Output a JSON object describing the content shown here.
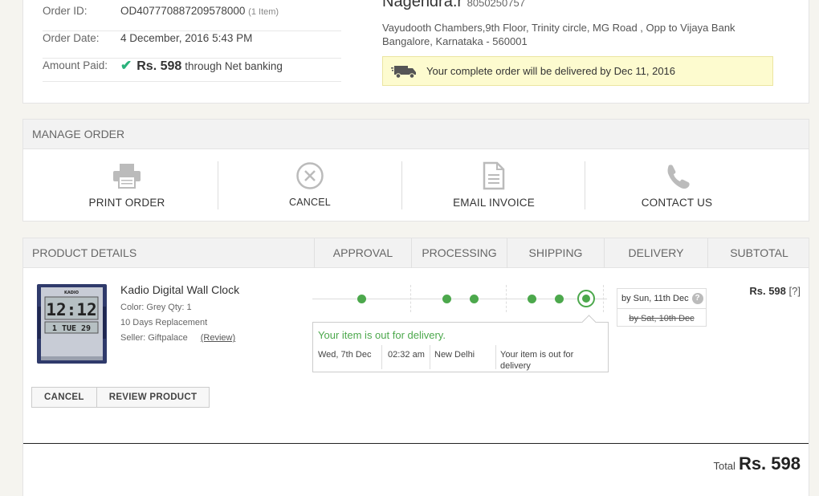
{
  "order": {
    "id_label": "Order ID:",
    "id": "OD407770887209578000",
    "items": "(1 Item)",
    "date_label": "Order Date:",
    "date": "4 December, 2016 5:43 PM",
    "amount_label": "Amount Paid:",
    "amount": "Rs. 598",
    "payment_method": "through Net banking"
  },
  "customer": {
    "name": "Nagendra.r",
    "phone": "8050250757",
    "address_line1": "Vayudooth Chambers,9th Floor, Trinity circle, MG Road , Opp to Vijaya Bank",
    "address_line2": "Bangalore, Karnataka - 560001"
  },
  "delivery_banner": "Your complete order will be delivered by Dec 11, 2016",
  "manage": {
    "title": "MANAGE ORDER",
    "actions": [
      {
        "label": "PRINT ORDER",
        "icon": "printer-icon"
      },
      {
        "label": "CANCEL",
        "icon": "cancel-circle-icon"
      },
      {
        "label": "EMAIL INVOICE",
        "icon": "document-icon"
      },
      {
        "label": "CONTACT US",
        "icon": "phone-icon"
      }
    ]
  },
  "product_table": {
    "headers": [
      "PRODUCT DETAILS",
      "APPROVAL",
      "PROCESSING",
      "SHIPPING",
      "DELIVERY",
      "SUBTOTAL"
    ]
  },
  "product": {
    "name": "Kadio Digital Wall Clock",
    "color_qty": "Color: Grey  Qty: 1",
    "replacement": "10 Days Replacement",
    "seller": "Seller: Giftpalace",
    "review_link": "(Review)",
    "clock_brand": "KADIO",
    "clock_time": "12:12",
    "clock_day": "1 TUE 29",
    "subtotal": "Rs. 598",
    "subtotal_help": "[?]"
  },
  "tracking": {
    "status": "Your item is out for delivery.",
    "date": "Wed, 7th Dec",
    "time": "02:32 am",
    "location": "New Delhi",
    "detail": "Your item is out for delivery",
    "eta_new": "by Sun, 11th Dec",
    "eta_help": "?",
    "eta_old": "by Sat, 10th Dec"
  },
  "buttons": {
    "cancel": "CANCEL",
    "review": "REVIEW PRODUCT"
  },
  "total": {
    "label": "Total",
    "value": "Rs. 598"
  },
  "colors": {
    "accent_green": "#4ca84c",
    "tick_green": "#2ab27b",
    "banner_bg": "#fdfbcf"
  }
}
